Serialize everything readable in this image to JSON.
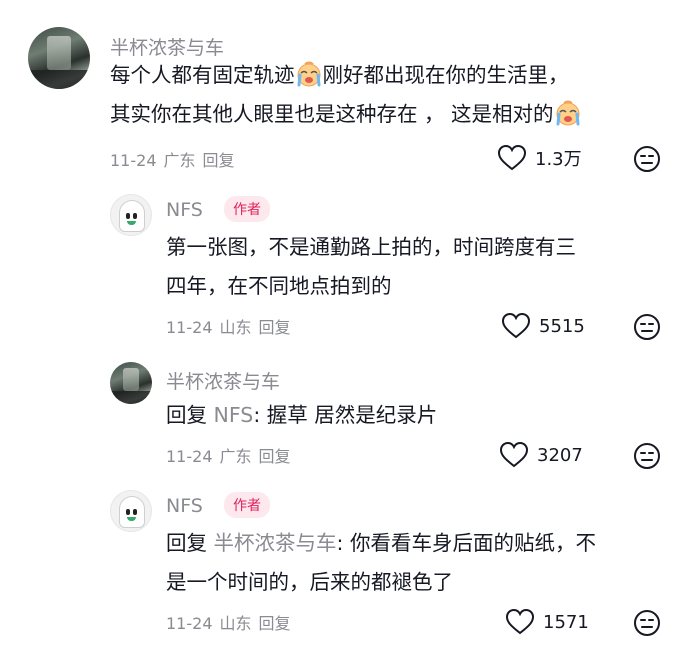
{
  "comments": [
    {
      "author": "半杯浓茶与车",
      "text_part1": "每个人都有固定轨迹",
      "text_part2": "刚好都出现在你的生活里，",
      "text_line2": "其实你在其他人眼里也是这种存在 ，  这是相对的",
      "inline_emoji": "crying-face",
      "date": "11-24",
      "location": "广东",
      "reply_label": "回复",
      "likes": "1.3万"
    },
    {
      "author": "NFS",
      "badge": "作者",
      "text_line1": "第一张图，不是通勤路上拍的，时间跨度有三",
      "text_line2": "四年，在不同地点拍到的",
      "date": "11-24",
      "location": "山东",
      "reply_label": "回复",
      "likes": "5515"
    },
    {
      "author": "半杯浓茶与车",
      "reply_prefix": "回复",
      "reply_target": "NFS",
      "text": ": 握草 居然是纪录片",
      "date": "11-24",
      "location": "广东",
      "reply_label": "回复",
      "likes": "3207"
    },
    {
      "author": "NFS",
      "badge": "作者",
      "reply_prefix": "回复",
      "reply_target": "半杯浓茶与车",
      "text_line1": ": 你看看车身后面的贴纸，不",
      "text_line2": "是一个时间的，后来的都褪色了",
      "date": "11-24",
      "location": "山东",
      "reply_label": "回复",
      "likes": "1571"
    }
  ],
  "icons": {
    "like": "heart-outline-icon",
    "dislike": "meh-face-icon"
  },
  "colors": {
    "text": "#161823",
    "secondary": "#8a8b91",
    "badge_text": "#e0245e",
    "badge_bg": "#fde8ee"
  }
}
